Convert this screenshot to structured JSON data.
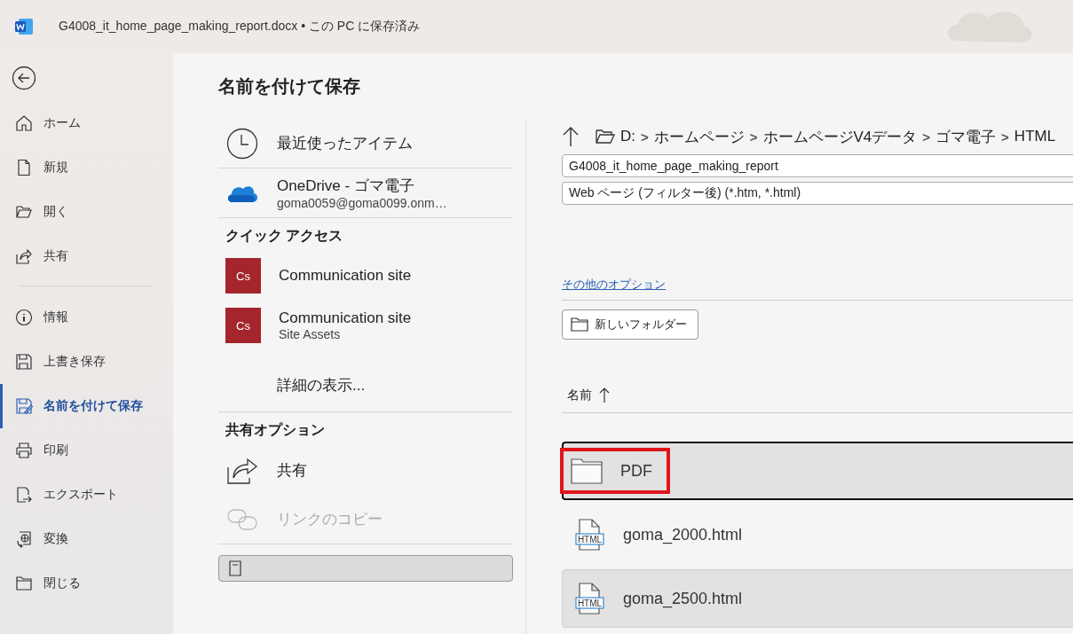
{
  "window": {
    "title": "G4008_it_home_page_making_report.docx • この PC に保存済み"
  },
  "sidebar": {
    "top": [
      {
        "kind": "home",
        "label": "ホーム",
        "selected": false
      },
      {
        "kind": "new",
        "label": "新規",
        "selected": false
      },
      {
        "kind": "open",
        "label": "開く",
        "selected": false
      },
      {
        "kind": "share",
        "label": "共有",
        "selected": false
      }
    ],
    "bottom": [
      {
        "kind": "info",
        "label": "情報",
        "selected": false
      },
      {
        "kind": "save",
        "label": "上書き保存",
        "selected": false
      },
      {
        "kind": "saveas",
        "label": "名前を付けて保存",
        "selected": true
      },
      {
        "kind": "print",
        "label": "印刷",
        "selected": false
      },
      {
        "kind": "export",
        "label": "エクスポート",
        "selected": false
      },
      {
        "kind": "convert",
        "label": "変換",
        "selected": false
      },
      {
        "kind": "close",
        "label": "閉じる",
        "selected": false
      }
    ]
  },
  "page": {
    "title": "名前を付けて保存"
  },
  "locations": [
    {
      "kind": "recent",
      "label": "最近使ったアイテム"
    },
    {
      "kind": "onedrive",
      "label": "OneDrive - ゴマ電子",
      "sub": "goma0059@goma0099.onm…"
    },
    {
      "kind": "heading",
      "label": "クイック アクセス"
    },
    {
      "kind": "site",
      "badge": "Cs",
      "label": "Communication site"
    },
    {
      "kind": "site",
      "badge": "Cs",
      "label": "Communication site",
      "sub": "Site Assets"
    },
    {
      "kind": "more",
      "label": "詳細の表示..."
    },
    {
      "kind": "heading",
      "label": "共有オプション"
    },
    {
      "kind": "share",
      "label": "共有",
      "disabled": false
    },
    {
      "kind": "link",
      "label": "リンクのコピー",
      "disabled": true
    },
    {
      "kind": "browse",
      "selected": true
    }
  ],
  "save_panel": {
    "breadcrumb": [
      {
        "kind": "folder",
        "label": "D:"
      },
      {
        "kind": "separator",
        "label": ">"
      },
      {
        "kind": "folder",
        "label": "ホームページ"
      },
      {
        "kind": "separator",
        "label": ">"
      },
      {
        "kind": "folder",
        "label": "ホームページV4データ"
      },
      {
        "kind": "separator",
        "label": ">"
      },
      {
        "kind": "folder",
        "label": "ゴマ電子"
      },
      {
        "kind": "separator",
        "label": ">"
      },
      {
        "kind": "folder",
        "label": "HTML"
      }
    ],
    "file_name": "G4008_it_home_page_making_report",
    "file_type": "Web ページ (フィルター後) (*.htm, *.html)",
    "more_options": "その他のオプション",
    "new_folder": "新しいフォルダー",
    "column": "名前",
    "files": [
      {
        "kind": "folder",
        "name": "PDF",
        "selected": true,
        "focused": true,
        "marked": true
      },
      {
        "kind": "html",
        "badge": "HTML",
        "name": "goma_2000.html",
        "selected": false,
        "focused": false,
        "marked": false
      },
      {
        "kind": "html",
        "badge": "HTML",
        "name": "goma_2500.html",
        "selected": true,
        "focused": false,
        "marked": false
      }
    ]
  }
}
